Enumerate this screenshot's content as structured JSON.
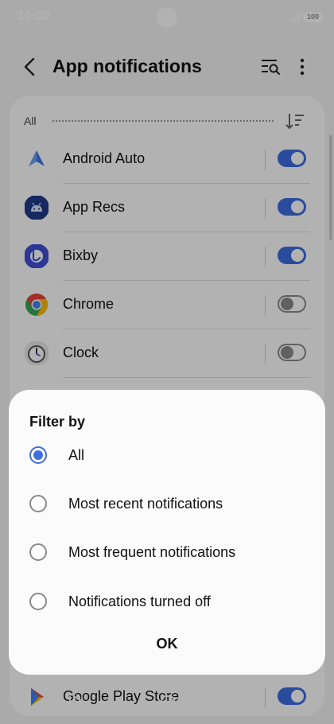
{
  "status_bar": {
    "time": "10:00",
    "battery": "100"
  },
  "header": {
    "title": "App notifications"
  },
  "filter_bar": {
    "label": "All"
  },
  "apps": [
    {
      "name": "Android Auto",
      "enabled": true
    },
    {
      "name": "App Recs",
      "enabled": true
    },
    {
      "name": "Bixby",
      "enabled": true
    },
    {
      "name": "Chrome",
      "enabled": false
    },
    {
      "name": "Clock",
      "enabled": false
    },
    {
      "name": "Google Play Store",
      "enabled": true
    }
  ],
  "dialog": {
    "title": "Filter by",
    "options": [
      {
        "label": "All",
        "selected": true
      },
      {
        "label": "Most recent notifications",
        "selected": false
      },
      {
        "label": "Most frequent notifications",
        "selected": false
      },
      {
        "label": "Notifications turned off",
        "selected": false
      }
    ],
    "ok_label": "OK"
  },
  "colors": {
    "accent": "#3e6ee0",
    "toggle_off": "#8a8a8a",
    "background": "#f4f4f4"
  },
  "icons": {
    "back": "back-arrow-icon",
    "search": "search-list-icon",
    "more": "more-vertical-icon",
    "sort": "sort-icon",
    "nav_recents": "recents-icon",
    "nav_home": "home-icon",
    "nav_back": "back-chevron-icon"
  }
}
